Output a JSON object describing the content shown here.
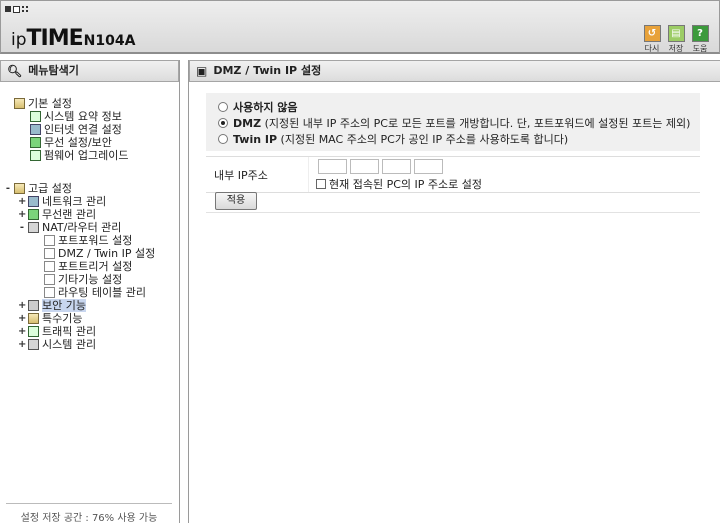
{
  "header": {
    "logo_ip": "ip",
    "logo_time": "TIME",
    "logo_model": "N104A",
    "buttons": [
      {
        "label": "다시",
        "icon": "refresh-icon",
        "color": "#e8a23a",
        "glyph": "↺"
      },
      {
        "label": "저장",
        "icon": "save-icon",
        "color": "#9ccc65",
        "glyph": "▤"
      },
      {
        "label": "도움",
        "icon": "help-icon",
        "color": "#3c9a3c",
        "glyph": "?"
      }
    ]
  },
  "left_panel": {
    "title": "메뉴탐색기",
    "footer": "설정 저장 공간 : 76% 사용 가능",
    "groups": [
      {
        "label": "기본 설정",
        "expander": "-",
        "items": [
          "시스템 요약 정보",
          "인터넷 연결 설정",
          "무선 설정/보안",
          "펌웨어 업그레이드"
        ]
      },
      {
        "label": "고급 설정",
        "expander": "-",
        "items": [
          {
            "label": "네트워크 관리",
            "expander": "+"
          },
          {
            "label": "무선랜 관리",
            "expander": "+"
          },
          {
            "label": "NAT/라우터 관리",
            "expander": "-",
            "children": [
              "포트포워드 설정",
              "DMZ / Twin IP 설정",
              "포트트리거 설정",
              "기타기능 설정",
              "라우팅 테이블 관리"
            ]
          },
          {
            "label": "보안 기능",
            "expander": "+"
          },
          {
            "label": "특수기능",
            "expander": "+"
          },
          {
            "label": "트래픽 관리",
            "expander": "+"
          },
          {
            "label": "시스템 관리",
            "expander": "+"
          }
        ]
      }
    ]
  },
  "right_panel": {
    "title": "DMZ / Twin IP 설정",
    "options": [
      {
        "name": "사용하지 않음",
        "desc": "",
        "selected": false
      },
      {
        "name": "DMZ",
        "desc": "(지정된 내부 IP 주소의 PC로 모든 포트를 개방합니다. 단, 포트포워드에 설정된 포트는 제외)",
        "selected": true
      },
      {
        "name": "Twin IP",
        "desc": "(지정된 MAC 주소의 PC가 공인 IP 주소를 사용하도록 합니다)",
        "selected": false
      }
    ],
    "internal_ip_label": "내부 IP주소",
    "ip_octets": [
      "",
      "",
      "",
      ""
    ],
    "use_current_pc_label": "현재 접속된 PC의 IP 주소로 설정",
    "apply_label": "적용"
  }
}
